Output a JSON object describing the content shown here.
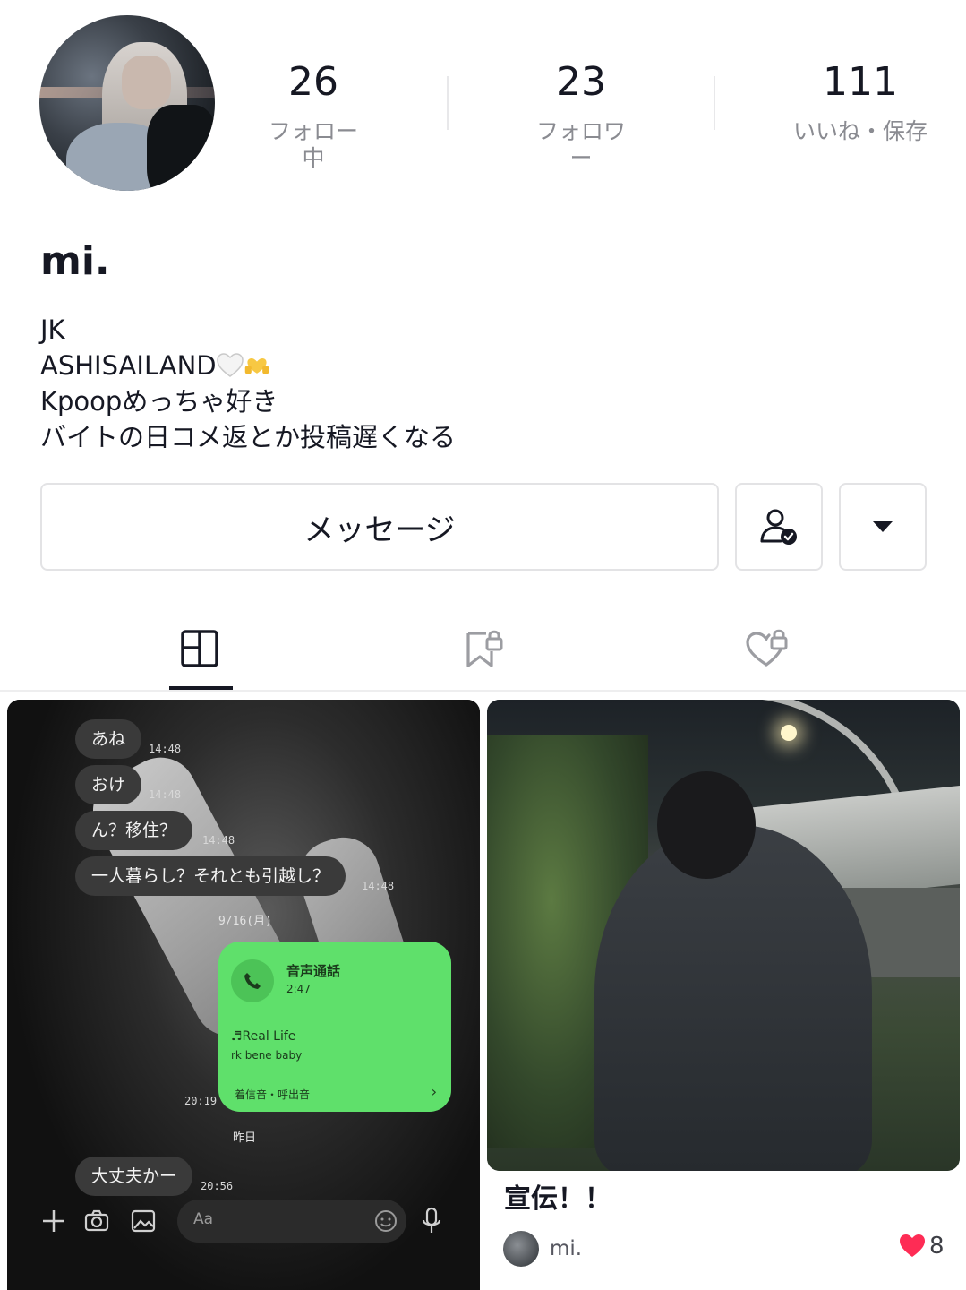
{
  "profile": {
    "username": "mi.",
    "bio": [
      "JK",
      "ASHISAILAND",
      "Kpoopめっちゃ好き",
      "バイトの日コメ返とか投稿遅くなる"
    ]
  },
  "stats": [
    {
      "value": "26",
      "label": "フォロー中"
    },
    {
      "value": "23",
      "label": "フォロワー"
    },
    {
      "value": "111",
      "label": "いいね・保存"
    }
  ],
  "actions": {
    "message_label": "メッセージ",
    "friend_icon": "user-check-icon",
    "more_icon": "caret-down-icon"
  },
  "tabs": [
    {
      "icon": "grid-icon",
      "active": true
    },
    {
      "icon": "bookmark-lock-icon",
      "active": false
    },
    {
      "icon": "heart-lock-icon",
      "active": false
    }
  ],
  "posts": {
    "left": {
      "chat": {
        "messages": [
          {
            "text": "あね",
            "time": "14:48"
          },
          {
            "text": "おけ",
            "time": "14:48"
          },
          {
            "text": "ん？移住？",
            "time": "14:48"
          },
          {
            "text": "一人暮らし？それとも引越し？",
            "time": "14:48"
          }
        ],
        "date_divider": "9/16(月)",
        "call": {
          "title": "音声通話",
          "duration": "2:47",
          "song": "♬Real Life",
          "artist": "rk bene baby",
          "ringtone": "着信音・呼出音",
          "time": "20:19"
        },
        "date_divider2": "昨日",
        "last_message": {
          "text": "大丈夫かー",
          "time": "20:56"
        },
        "input_placeholder": "Aa"
      }
    },
    "right": {
      "title": "宣伝！！",
      "author": "mi.",
      "likes": "8"
    }
  },
  "colors": {
    "text_primary": "#161823",
    "text_secondary": "#8a8b91",
    "like_red": "#fe2c55",
    "line_green": "#5fe06b"
  }
}
